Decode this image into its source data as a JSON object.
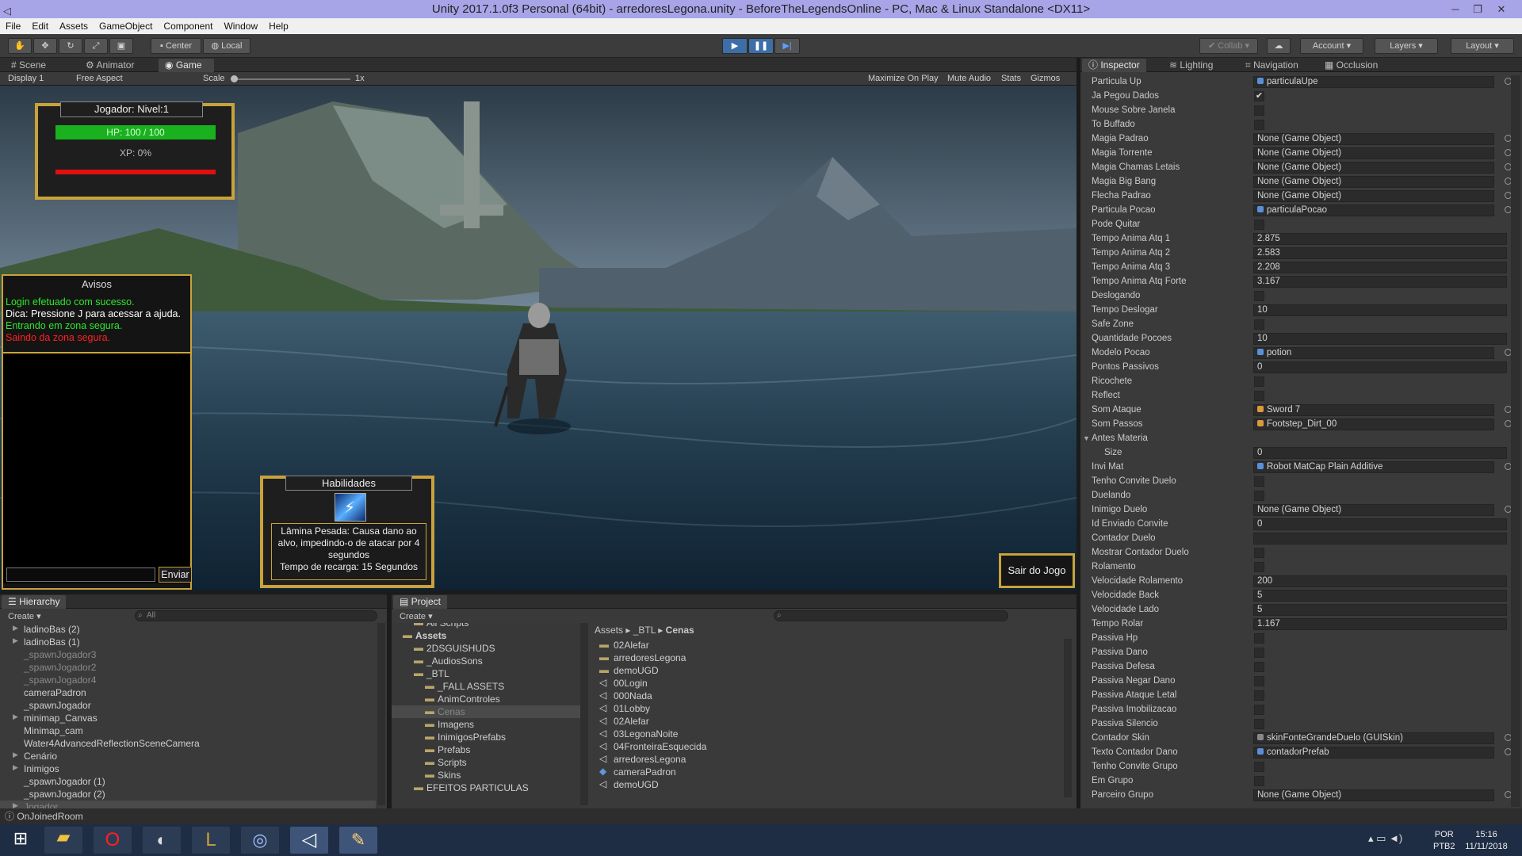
{
  "window": {
    "title": "Unity 2017.1.0f3 Personal (64bit) - arredoresLegona.unity - BeforeTheLegendsOnline - PC, Mac & Linux Standalone <DX11>"
  },
  "menu": [
    "File",
    "Edit",
    "Assets",
    "GameObject",
    "Component",
    "Window",
    "Help"
  ],
  "toolbar": {
    "center": "Center",
    "local": "Local",
    "collab": "Collab",
    "account": "Account",
    "layers": "Layers",
    "layout": "Layout"
  },
  "scene_tabs": {
    "scene": "Scene",
    "animator": "Animator",
    "game": "Game"
  },
  "game_bar": {
    "display": "Display 1",
    "aspect": "Free Aspect",
    "scale_label": "Scale",
    "scale_value": "1x",
    "maximize": "Maximize On Play",
    "mute": "Mute Audio",
    "stats": "Stats",
    "gizmos": "Gizmos"
  },
  "hud": {
    "player_title": "Jogador: Nivel:1",
    "hp": "HP: 100 / 100",
    "xp": "XP: 0%",
    "hp_fraction": 1.0,
    "xp_fraction": 0.0,
    "avisos_title": "Avisos",
    "messages": [
      {
        "text": "Login efetuado com sucesso.",
        "color": "#2ee82e"
      },
      {
        "text": "Dica: Pressione J para acessar a ajuda.",
        "color": "#ffffff"
      },
      {
        "text": "Entrando em zona segura.",
        "color": "#2ee82e"
      },
      {
        "text": "Saindo da zona segura.",
        "color": "#ff2020"
      }
    ],
    "send": "Enviar",
    "skills_title": "Habilidades",
    "skill_tooltip_1": "Lâmina Pesada: Causa dano ao alvo, impedindo-o de atacar por 4 segundos",
    "skill_tooltip_2": "Tempo de recarga: 15 Segundos",
    "exit": "Sair do Jogo"
  },
  "hierarchy": {
    "tab": "Hierarchy",
    "create": "Create",
    "search_placeholder": "All",
    "items": [
      {
        "text": "ladinoBas (2)",
        "indent": 1,
        "arrow": true,
        "dim": false
      },
      {
        "text": "ladinoBas (1)",
        "indent": 1,
        "arrow": true,
        "dim": false
      },
      {
        "text": "_spawnJogador3",
        "indent": 1,
        "arrow": false,
        "dim": true
      },
      {
        "text": "_spawnJogador2",
        "indent": 1,
        "arrow": false,
        "dim": true
      },
      {
        "text": "_spawnJogador4",
        "indent": 1,
        "arrow": false,
        "dim": true
      },
      {
        "text": "cameraPadron",
        "indent": 1,
        "arrow": false,
        "dim": false
      },
      {
        "text": "_spawnJogador",
        "indent": 1,
        "arrow": false,
        "dim": false
      },
      {
        "text": "minimap_Canvas",
        "indent": 1,
        "arrow": true,
        "dim": false
      },
      {
        "text": "Minimap_cam",
        "indent": 1,
        "arrow": false,
        "dim": false
      },
      {
        "text": "Water4AdvancedReflectionSceneCamera",
        "indent": 1,
        "arrow": false,
        "dim": false
      },
      {
        "text": "Cenário",
        "indent": 1,
        "arrow": true,
        "dim": false
      },
      {
        "text": "Inimigos",
        "indent": 1,
        "arrow": true,
        "dim": false
      },
      {
        "text": "_spawnJogador (1)",
        "indent": 1,
        "arrow": false,
        "dim": false
      },
      {
        "text": "_spawnJogador (2)",
        "indent": 1,
        "arrow": false,
        "dim": false
      },
      {
        "text": "Jogador",
        "indent": 1,
        "arrow": true,
        "dim": true
      }
    ]
  },
  "project": {
    "tab": "Project",
    "create": "Create",
    "tree": [
      {
        "text": "All Scripts",
        "indent": 1,
        "bold": false
      },
      {
        "text": "Assets",
        "indent": 0,
        "bold": true
      },
      {
        "text": "2DSGUISHUDS",
        "indent": 1,
        "bold": false
      },
      {
        "text": "_AudiosSons",
        "indent": 1,
        "bold": false
      },
      {
        "text": "_BTL",
        "indent": 1,
        "bold": false
      },
      {
        "text": "_FALL ASSETS",
        "indent": 2,
        "bold": false
      },
      {
        "text": "AnimControles",
        "indent": 2,
        "bold": false
      },
      {
        "text": "Cenas",
        "indent": 2,
        "bold": false
      },
      {
        "text": "Imagens",
        "indent": 2,
        "bold": false
      },
      {
        "text": "InimigosPrefabs",
        "indent": 2,
        "bold": false
      },
      {
        "text": "Prefabs",
        "indent": 2,
        "bold": false
      },
      {
        "text": "Scripts",
        "indent": 2,
        "bold": false
      },
      {
        "text": "Skins",
        "indent": 2,
        "bold": false
      },
      {
        "text": "EFEITOS PARTICULAS",
        "indent": 1,
        "bold": false
      }
    ],
    "breadcrumb": [
      "Assets",
      "_BTL",
      "Cenas"
    ],
    "files": [
      {
        "text": "02Alefar",
        "type": "folder"
      },
      {
        "text": "arredoresLegona",
        "type": "folder"
      },
      {
        "text": "demoUGD",
        "type": "folder"
      },
      {
        "text": "00Login",
        "type": "scene"
      },
      {
        "text": "000Nada",
        "type": "scene"
      },
      {
        "text": "01Lobby",
        "type": "scene"
      },
      {
        "text": "02Alefar",
        "type": "scene"
      },
      {
        "text": "03LegonaNoite",
        "type": "scene"
      },
      {
        "text": "04FronteiraEsquecida",
        "type": "scene"
      },
      {
        "text": "arredoresLegona",
        "type": "scene"
      },
      {
        "text": "cameraPadron",
        "type": "asset"
      },
      {
        "text": "demoUGD",
        "type": "scene"
      }
    ]
  },
  "inspector_tabs": {
    "inspector": "Inspector",
    "lighting": "Lighting",
    "navigation": "Navigation",
    "occlusion": "Occlusion"
  },
  "inspector": [
    {
      "label": "Particula Up",
      "kind": "obj",
      "value": "particulaUpe",
      "icon": "#5a8fd8"
    },
    {
      "label": "Ja Pegou Dados",
      "kind": "check",
      "value": "✔"
    },
    {
      "label": "Mouse Sobre Janela",
      "kind": "check",
      "value": ""
    },
    {
      "label": "To Buffado",
      "kind": "check",
      "value": ""
    },
    {
      "label": "Magia Padrao",
      "kind": "obj",
      "value": "None (Game Object)",
      "icon": ""
    },
    {
      "label": "Magia Torrente",
      "kind": "obj",
      "value": "None (Game Object)",
      "icon": ""
    },
    {
      "label": "Magia Chamas Letais",
      "kind": "obj",
      "value": "None (Game Object)",
      "icon": ""
    },
    {
      "label": "Magia Big Bang",
      "kind": "obj",
      "value": "None (Game Object)",
      "icon": ""
    },
    {
      "label": "Flecha Padrao",
      "kind": "obj",
      "value": "None (Game Object)",
      "icon": ""
    },
    {
      "label": "Particula Pocao",
      "kind": "obj",
      "value": "particulaPocao",
      "icon": "#5a8fd8"
    },
    {
      "label": "Pode Quitar",
      "kind": "check",
      "value": ""
    },
    {
      "label": "Tempo Anima Atq 1",
      "kind": "text",
      "value": "2.875"
    },
    {
      "label": "Tempo Anima Atq 2",
      "kind": "text",
      "value": "2.583"
    },
    {
      "label": "Tempo Anima Atq 3",
      "kind": "text",
      "value": "2.208"
    },
    {
      "label": "Tempo Anima Atq Forte",
      "kind": "text",
      "value": "3.167"
    },
    {
      "label": "Deslogando",
      "kind": "check",
      "value": ""
    },
    {
      "label": "Tempo Deslogar",
      "kind": "text",
      "value": "10"
    },
    {
      "label": "Safe Zone",
      "kind": "check",
      "value": ""
    },
    {
      "label": "Quantidade Pocoes",
      "kind": "text",
      "value": "10"
    },
    {
      "label": "Modelo Pocao",
      "kind": "obj",
      "value": "potion",
      "icon": "#5a8fd8"
    },
    {
      "label": "Pontos Passivos",
      "kind": "text",
      "value": "0"
    },
    {
      "label": "Ricochete",
      "kind": "check",
      "value": ""
    },
    {
      "label": "Reflect",
      "kind": "check",
      "value": ""
    },
    {
      "label": "Som Ataque",
      "kind": "obj",
      "value": "Sword 7",
      "icon": "#d89a3a"
    },
    {
      "label": "Som Passos",
      "kind": "obj",
      "value": "Footstep_Dirt_00",
      "icon": "#d89a3a"
    },
    {
      "label": "Antes Materia",
      "kind": "header",
      "value": ""
    },
    {
      "label": "Size",
      "kind": "textsub",
      "value": "0"
    },
    {
      "label": "Invi Mat",
      "kind": "obj",
      "value": "Robot MatCap Plain Additive",
      "icon": "#5a8fd8"
    },
    {
      "label": "Tenho Convite Duelo",
      "kind": "check",
      "value": ""
    },
    {
      "label": "Duelando",
      "kind": "check",
      "value": ""
    },
    {
      "label": "Inimigo Duelo",
      "kind": "obj",
      "value": "None (Game Object)",
      "icon": ""
    },
    {
      "label": "Id Enviado Convite",
      "kind": "text",
      "value": "0"
    },
    {
      "label": "Contador Duelo",
      "kind": "text",
      "value": ""
    },
    {
      "label": "Mostrar Contador Duelo",
      "kind": "check",
      "value": ""
    },
    {
      "label": "Rolamento",
      "kind": "check",
      "value": ""
    },
    {
      "label": "Velocidade Rolamento",
      "kind": "text",
      "value": "200"
    },
    {
      "label": "Velocidade Back",
      "kind": "text",
      "value": "5"
    },
    {
      "label": "Velocidade Lado",
      "kind": "text",
      "value": "5"
    },
    {
      "label": "Tempo Rolar",
      "kind": "text",
      "value": "1.167"
    },
    {
      "label": "Passiva Hp",
      "kind": "check",
      "value": ""
    },
    {
      "label": "Passiva Dano",
      "kind": "check",
      "value": ""
    },
    {
      "label": "Passiva Defesa",
      "kind": "check",
      "value": ""
    },
    {
      "label": "Passiva Negar Dano",
      "kind": "check",
      "value": ""
    },
    {
      "label": "Passiva Ataque Letal",
      "kind": "check",
      "value": ""
    },
    {
      "label": "Passiva Imobilizacao",
      "kind": "check",
      "value": ""
    },
    {
      "label": "Passiva Silencio",
      "kind": "check",
      "value": ""
    },
    {
      "label": "Contador Skin",
      "kind": "obj",
      "value": "skinFonteGrandeDuelo (GUISkin)",
      "icon": "#888888"
    },
    {
      "label": "Texto Contador Dano",
      "kind": "obj",
      "value": "contadorPrefab",
      "icon": "#5a8fd8"
    },
    {
      "label": "Tenho Convite Grupo",
      "kind": "check",
      "value": ""
    },
    {
      "label": "Em Grupo",
      "kind": "check",
      "value": ""
    },
    {
      "label": "Parceiro Grupo",
      "kind": "obj",
      "value": "None (Game Object)",
      "icon": ""
    }
  ],
  "statusbar": "OnJoinedRoom",
  "taskbar": {
    "lang1": "POR",
    "lang2": "PTB2",
    "time": "15:16",
    "date": "11/11/2018"
  }
}
